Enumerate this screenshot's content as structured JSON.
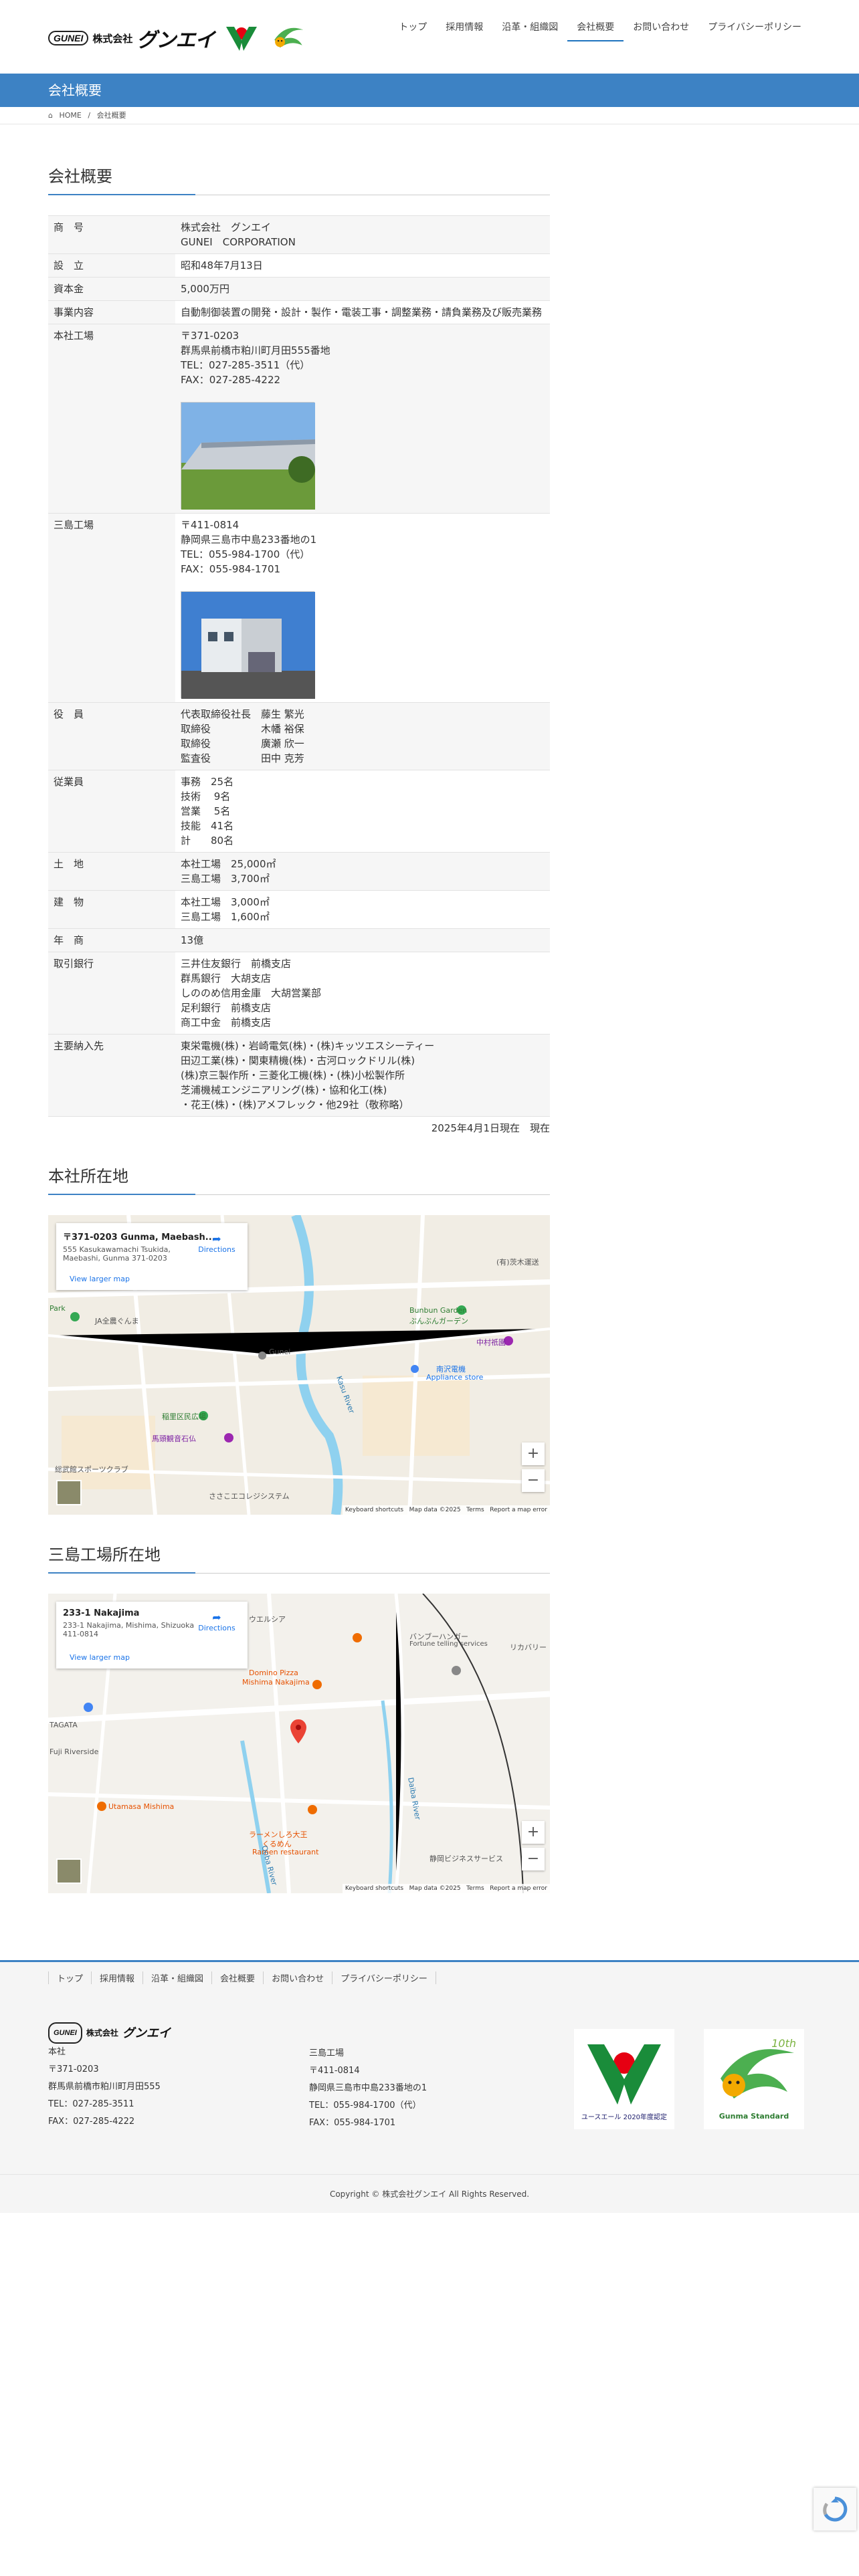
{
  "header": {
    "logo_gunei": "GUNEI",
    "logo_corp": "株式会社",
    "logo_name": "グンエイ",
    "nav": [
      {
        "label": "トップ"
      },
      {
        "label": "採用情報"
      },
      {
        "label": "沿革・組織図"
      },
      {
        "label": "会社概要",
        "active": true
      },
      {
        "label": "お問い合わせ"
      },
      {
        "label": "プライバシーポリシー"
      }
    ]
  },
  "titlebar": {
    "title": "会社概要"
  },
  "breadcrumb": {
    "home": "HOME",
    "sep": "/",
    "current": "会社概要"
  },
  "overview": {
    "heading": "会社概要",
    "rows": [
      {
        "key": "商　号",
        "lines": [
          "株式会社　グンエイ",
          "GUNEI　CORPORATION"
        ]
      },
      {
        "key": "設　立",
        "lines": [
          "昭和48年7月13日"
        ]
      },
      {
        "key": "資本金",
        "lines": [
          "5,000万円"
        ]
      },
      {
        "key": "事業内容",
        "lines": [
          "自動制御装置の開発・設計・製作・電装工事・調整業務・請負業務及び販売業務"
        ]
      },
      {
        "key": "本社工場",
        "lines": [
          "〒371-0203",
          "群馬県前橋市粕川町月田555番地",
          "TEL：027-285-3511（代）",
          "FAX：027-285-4222"
        ]
      },
      {
        "key": "三島工場",
        "lines": [
          "〒411-0814",
          "静岡県三島市中島233番地の1",
          "TEL：055-984-1700（代）",
          "FAX：055-984-1701"
        ]
      },
      {
        "key": "役　員",
        "lines": [
          "代表取締役社長　藤生 繁光",
          "取締役　　　　　木幡 裕保",
          "取締役　　　　　廣瀬 欣一",
          "監査役　　　　　田中 克芳"
        ]
      },
      {
        "key": "従業員",
        "lines": [
          "事務　25名",
          "技術　 9名",
          "営業　 5名",
          "技能　41名",
          "計　　80名"
        ]
      },
      {
        "key": "土　地",
        "lines": [
          "本社工場　25,000㎡",
          "三島工場　3,700㎡"
        ]
      },
      {
        "key": "建　物",
        "lines": [
          "本社工場　3,000㎡",
          "三島工場　1,600㎡"
        ]
      },
      {
        "key": "年　商",
        "lines": [
          "13億"
        ]
      },
      {
        "key": "取引銀行",
        "lines": [
          "三井住友銀行　前橋支店",
          "群馬銀行　大胡支店",
          "しののめ信用金庫　大胡営業部",
          "足利銀行　前橋支店",
          "商工中金　前橋支店"
        ]
      },
      {
        "key": "主要納入先",
        "lines": [
          "東栄電機(株)・岩崎電気(株)・(株)キッツエスシーティー",
          "田辺工業(株)・関東精機(株)・古河ロックドリル(株)",
          "(株)京三製作所・三菱化工機(株)・(株)小松製作所",
          "芝浦機械エンジニアリング(株)・協和化工(株)",
          "・花王(株)・(株)アメフレック・他29社（敬称略）"
        ]
      }
    ],
    "as_of": "2025年4月1日現在　現在"
  },
  "hq_map": {
    "heading": "本社所在地",
    "card_title": "〒371-0203 Gunma, Maebash...",
    "card_address": [
      "555 Kasukawamachi Tsukida,",
      "Maebashi, Gunma 371-0203"
    ],
    "directions": "Directions",
    "larger": "View larger map",
    "labels": [
      "Bunbun Garden",
      "ぶんぶんガーデン",
      "南沢電機",
      "Appliance store",
      "中村祇園",
      "稲里区民広場",
      "馬頭観音石仏",
      "総武館スポーツクラブ",
      "(有)茨木運送",
      "JA全農ぐんま",
      "Gunei",
      "Park",
      "Kasu River",
      "ささこエコレジシステム"
    ],
    "footer": [
      "Keyboard shortcuts",
      "Map data ©2025",
      "Terms",
      "Report a map error"
    ]
  },
  "mishima_map": {
    "heading": "三島工場所在地",
    "card_title": "233-1 Nakajima",
    "card_address": [
      "233-1 Nakajima, Mishima, Shizuoka",
      "411-0814"
    ],
    "directions": "Directions",
    "larger": "View larger map",
    "labels": [
      "Domino Pizza",
      "Mishima Nakajima",
      "バンブーハンガー",
      "Fortune telling services",
      "リカバリー",
      "ウエルシア",
      "Utamasa Mishima",
      "ラーメンしろ大王",
      "くるめん",
      "Ramen restaurant",
      "静岡ビジネスサービス",
      "Daiba River",
      "Ooba River",
      "TAGATA",
      "Fuji Riverside"
    ],
    "footer": [
      "Keyboard shortcuts",
      "Map data ©2025",
      "Terms",
      "Report a map error"
    ]
  },
  "footer": {
    "nav": [
      {
        "label": "トップ"
      },
      {
        "label": "採用情報"
      },
      {
        "label": "沿革・組織図"
      },
      {
        "label": "会社概要"
      },
      {
        "label": "お問い合わせ"
      },
      {
        "label": "プライバシーポリシー"
      }
    ],
    "logo_gunei": "GUNEI",
    "logo_corp": "株式会社",
    "logo_name": "グンエイ",
    "hq": [
      "本社",
      "〒371-0203",
      "群馬県前橋市粕川町月田555",
      "TEL：027-285-3511",
      "FAX：027-285-4222"
    ],
    "mishima": [
      "三島工場",
      "〒411-0814",
      "静岡県三島市中島233番地の1",
      "TEL：055-984-1700（代）",
      "FAX：055-984-1701"
    ],
    "badge1_text": "ユースエール 2020年度認定",
    "badge2_text": "Gunma Standard",
    "badge2_num": "10th",
    "copyright": "Copyright © 株式会社グンエイ All Rights Reserved."
  },
  "colors": {
    "accent": "#3d82c4",
    "map_road": "#ffffff",
    "map_river": "#8fd1ef",
    "map_park": "#c8e6c0"
  }
}
